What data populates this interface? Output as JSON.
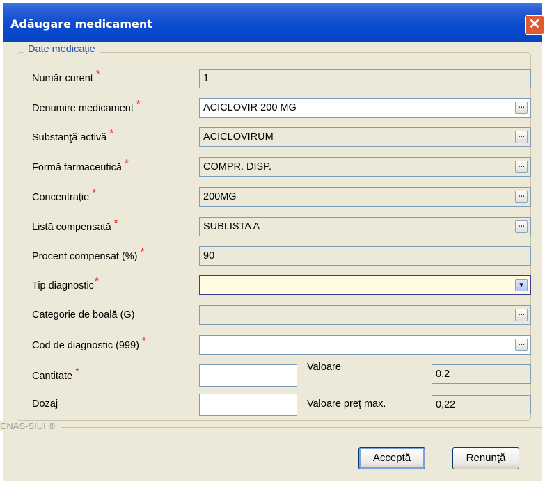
{
  "window": {
    "title": "Adăugare medicament",
    "close": "✕"
  },
  "group": {
    "title": "Date medicaţie"
  },
  "fields": {
    "numar_curent": {
      "label": "Număr curent",
      "value": "1"
    },
    "denumire": {
      "label": "Denumire medicament",
      "value": "ACICLOVIR 200 MG"
    },
    "substanta": {
      "label": "Substanţă activă",
      "value": "ACICLOVIRUM"
    },
    "forma": {
      "label": "Formă farmaceutică",
      "value": "COMPR. DISP."
    },
    "concentratie": {
      "label": "Concentraţie",
      "value": "200MG"
    },
    "lista": {
      "label": "Listă compensată",
      "value": "SUBLISTA A"
    },
    "procent": {
      "label": "Procent compensat (%)",
      "value": "90"
    },
    "tip_diagnostic": {
      "label": "Tip diagnostic",
      "value": ""
    },
    "categorie": {
      "label": "Categorie de boală (G)",
      "value": ""
    },
    "cod_diagnostic": {
      "label": "Cod de diagnostic (999)",
      "value": ""
    },
    "cantitate": {
      "label": "Cantitate",
      "value": ""
    },
    "dozaj": {
      "label": "Dozaj",
      "value": ""
    },
    "valoare": {
      "label": "Valoare",
      "value": "0,2"
    },
    "valoare_pret_max": {
      "label": "Valoare preţ max.",
      "value": "0,22"
    }
  },
  "required_marker": "*",
  "ellipsis": "...",
  "dropdown_glyph": "▾",
  "footer": {
    "brand": "CNAS-SIUI ®"
  },
  "buttons": {
    "accept": "Acceptă",
    "cancel": "Renunţă"
  }
}
